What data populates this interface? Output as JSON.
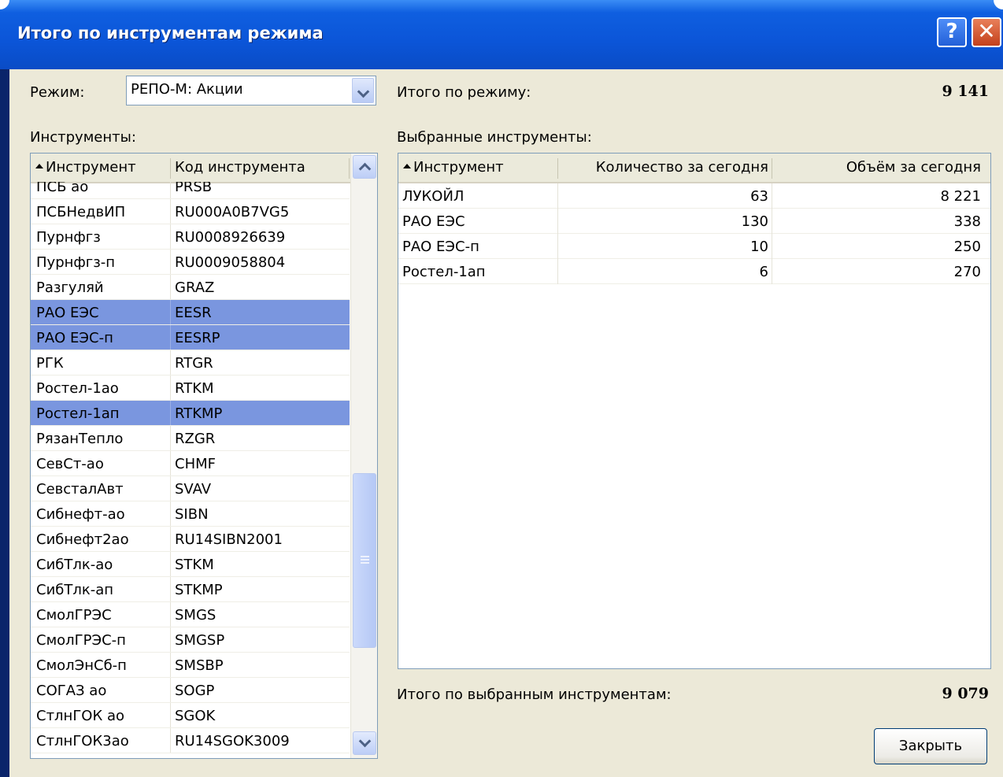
{
  "window": {
    "title": "Итого по инструментам режима",
    "help_glyph": "?",
    "close_glyph": "✕"
  },
  "mode": {
    "label": "Режим:",
    "value": "РЕПО-М: Акции"
  },
  "total_mode": {
    "label": "Итого по режиму:",
    "value": "9 141"
  },
  "instruments": {
    "label": "Инструменты:",
    "headers": {
      "name": "Инструмент",
      "code": "Код инструмента"
    },
    "rows": [
      {
        "name": "ПСБ ао",
        "code": "PRSB",
        "selected": false
      },
      {
        "name": "ПСБНедвИП",
        "code": "RU000A0B7VG5",
        "selected": false
      },
      {
        "name": "Пурнфгз",
        "code": "RU0008926639",
        "selected": false
      },
      {
        "name": "Пурнфгз-п",
        "code": "RU0009058804",
        "selected": false
      },
      {
        "name": "Разгуляй",
        "code": "GRAZ",
        "selected": false
      },
      {
        "name": "РАО ЕЭС",
        "code": "EESR",
        "selected": true
      },
      {
        "name": "РАО ЕЭС-п",
        "code": "EESRP",
        "selected": true
      },
      {
        "name": "РГК",
        "code": "RTGR",
        "selected": false
      },
      {
        "name": "Ростел-1ао",
        "code": "RTKM",
        "selected": false
      },
      {
        "name": "Ростел-1ап",
        "code": "RTKMP",
        "selected": true
      },
      {
        "name": "РязанТепло",
        "code": "RZGR",
        "selected": false
      },
      {
        "name": "СевСт-ао",
        "code": "CHMF",
        "selected": false
      },
      {
        "name": "СевсталАвт",
        "code": "SVAV",
        "selected": false
      },
      {
        "name": "Сибнефт-ао",
        "code": "SIBN",
        "selected": false
      },
      {
        "name": "Сибнефт2ао",
        "code": "RU14SIBN2001",
        "selected": false
      },
      {
        "name": "СибТлк-ао",
        "code": "STKM",
        "selected": false
      },
      {
        "name": "СибТлк-ап",
        "code": "STKMP",
        "selected": false
      },
      {
        "name": "СмолГРЭС",
        "code": "SMGS",
        "selected": false
      },
      {
        "name": "СмолГРЭС-п",
        "code": "SMGSP",
        "selected": false
      },
      {
        "name": "СмолЭнСб-п",
        "code": "SMSBP",
        "selected": false
      },
      {
        "name": "СОГАЗ ао",
        "code": "SOGP",
        "selected": false
      },
      {
        "name": "СтлнГОК ао",
        "code": "SGOK",
        "selected": false
      },
      {
        "name": "СтлнГОК3ао",
        "code": "RU14SGOK3009",
        "selected": false
      }
    ]
  },
  "selected_instruments": {
    "label": "Выбранные инструменты:",
    "headers": {
      "name": "Инструмент",
      "qty": "Количество за сегодня",
      "vol": "Объём за сегодня"
    },
    "rows": [
      {
        "name": "ЛУКОЙЛ",
        "qty": "63",
        "vol": "8 221"
      },
      {
        "name": "РАО ЕЭС",
        "qty": "130",
        "vol": "338"
      },
      {
        "name": "РАО ЕЭС-п",
        "qty": "10",
        "vol": "250"
      },
      {
        "name": "Ростел-1ап",
        "qty": "6",
        "vol": "270"
      }
    ]
  },
  "total_selected": {
    "label": "Итого по выбранным инструментам:",
    "value": "9 079"
  },
  "close_button": {
    "label": "Закрыть"
  },
  "colors": {
    "titlebar": "#0b55d8",
    "selection": "#7a96df",
    "dialog_bg": "#ece9d8"
  }
}
